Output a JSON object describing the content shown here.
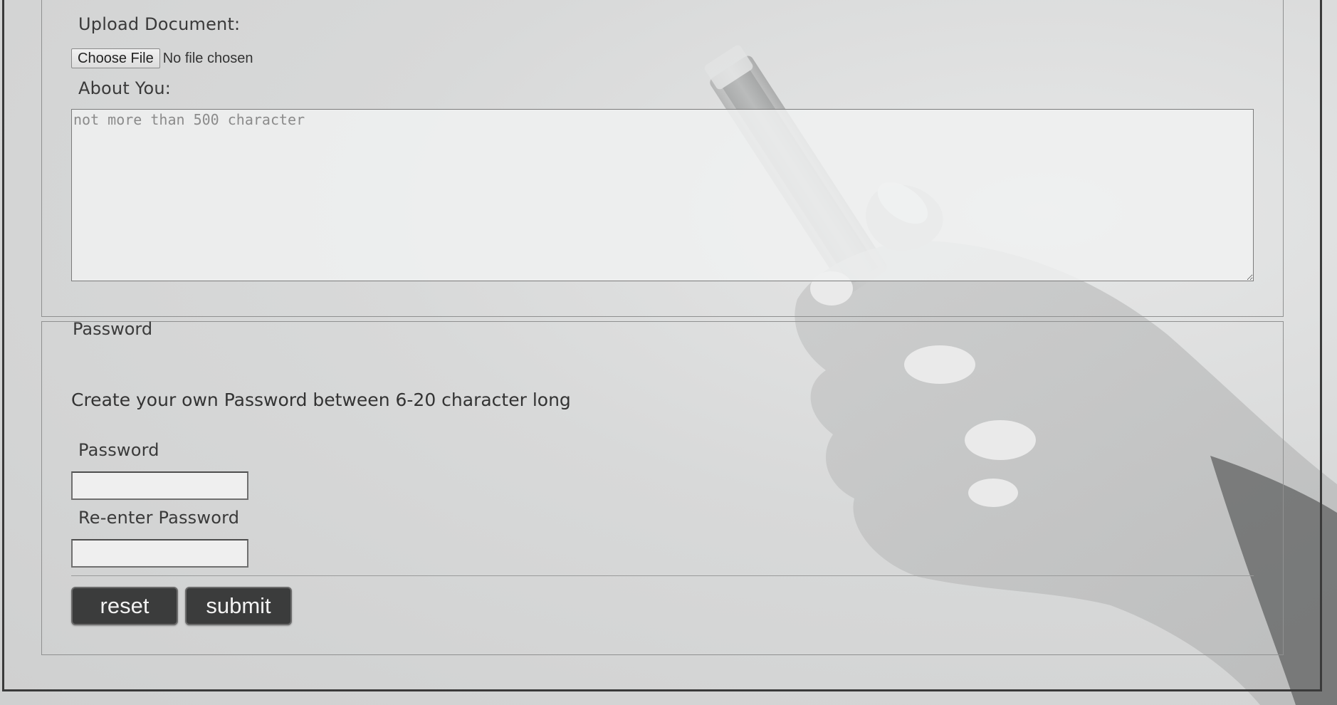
{
  "upload": {
    "label": "Upload Document:",
    "choose_button": "Choose File",
    "status": "No file chosen"
  },
  "about": {
    "label": "About You:",
    "placeholder": "not more than 500 character"
  },
  "password_section": {
    "legend": "Password",
    "hint": "Create your own Password between 6-20 character long",
    "password_label": "Password",
    "reenter_label": "Re-enter Password"
  },
  "actions": {
    "reset_label": "reset",
    "submit_label": "submit"
  },
  "colors": {
    "button_bg": "#3b3c3c",
    "page_bg": "#d4d5d5",
    "text": "#3a3a3a"
  }
}
